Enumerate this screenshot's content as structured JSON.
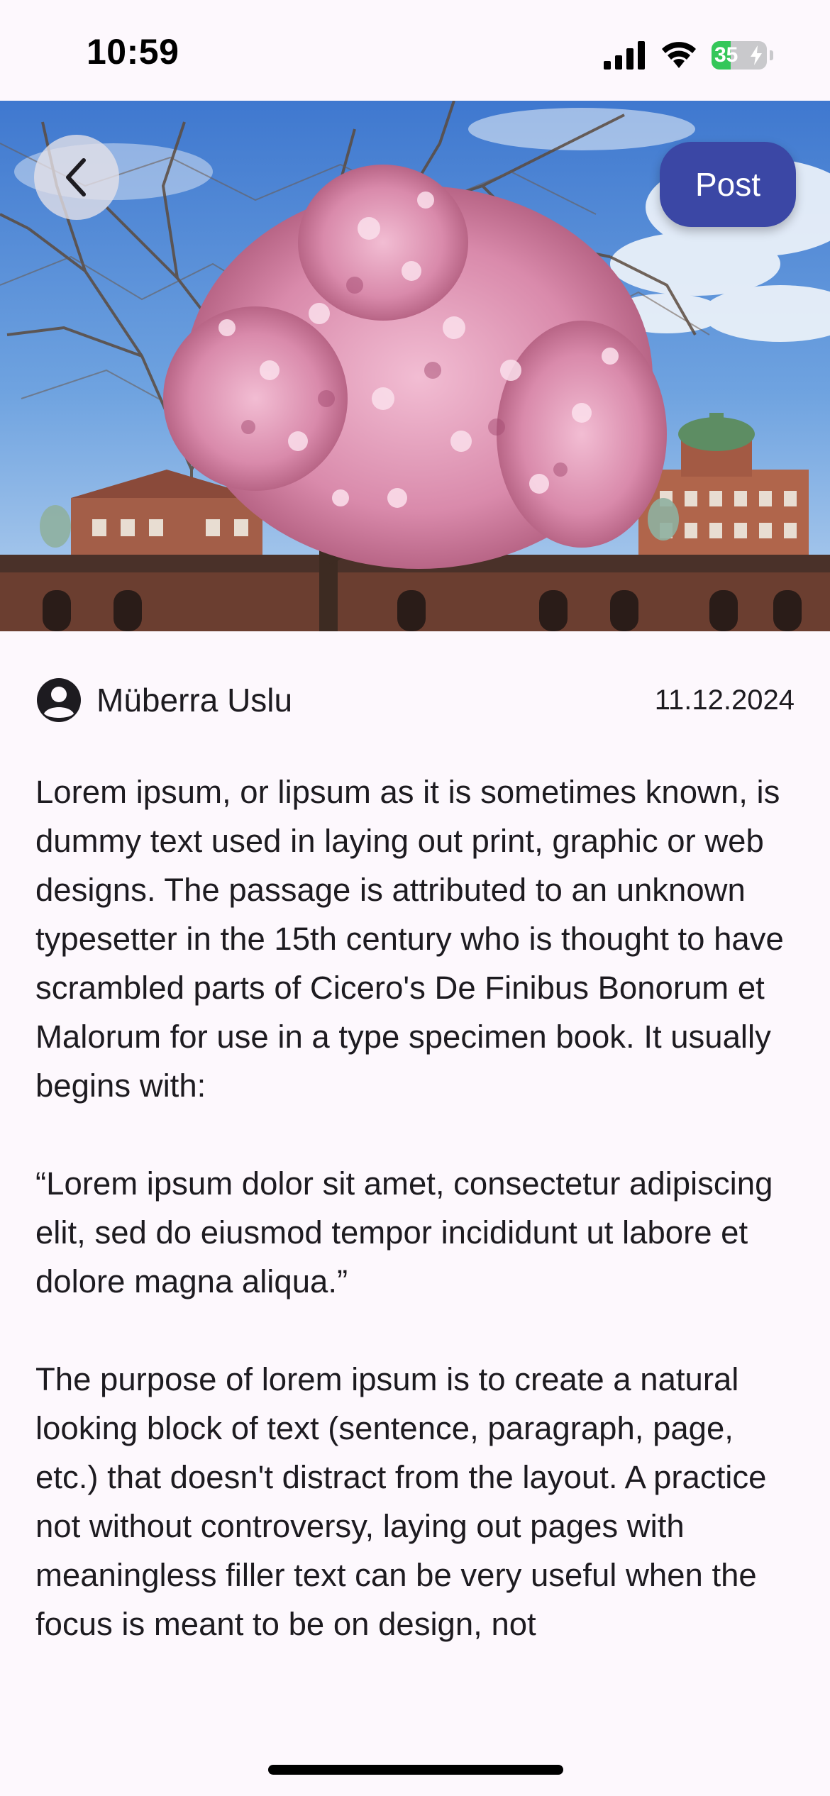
{
  "status_bar": {
    "time": "10:59",
    "battery_percent": 35,
    "battery_label": "35",
    "icons": [
      "cellular-signal-icon",
      "wifi-icon",
      "battery-charging-icon"
    ]
  },
  "hero": {
    "image_subject": "pink magnolia tree in bloom in front of historic brick buildings under a blue sky"
  },
  "header": {
    "back_icon": "chevron-left-icon",
    "post_button_label": "Post"
  },
  "post": {
    "author_icon": "account-circle-icon",
    "author_name": "Müberra Uslu",
    "date": "11.12.2024",
    "paragraphs": [
      "Lorem ipsum, or lipsum as it is sometimes known, is dummy text used in laying out print, graphic or web designs. The passage is attributed to an unknown typesetter in the 15th century who is thought to have scrambled parts of Cicero's De Finibus Bonorum et Malorum for use in a type specimen book. It usually begins with:",
      "“Lorem ipsum dolor sit amet, consectetur adipiscing elit, sed do eiusmod tempor incididunt ut labore et dolore magna aliqua.”",
      "The purpose of lorem ipsum is to create a natural looking block of text (sentence, paragraph, page, etc.) that doesn't distract from the layout. A practice not without controversy, laying out pages with meaningless filler text can be very useful when the focus is meant to be on design, not"
    ]
  },
  "colors": {
    "background": "#fdf8fd",
    "post_button": "#3b47a5",
    "text": "#1d1b20",
    "battery_fill": "#34c759"
  }
}
